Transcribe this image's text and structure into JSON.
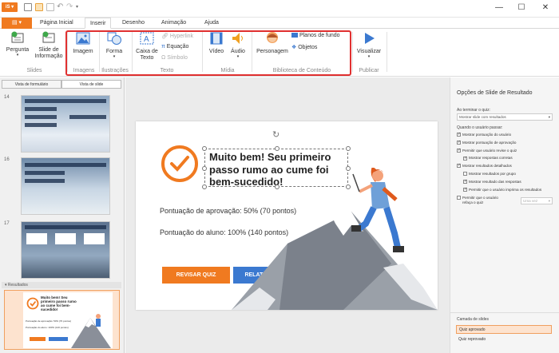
{
  "tabs": {
    "file": "Página Inicial",
    "items": [
      "Página Inicial",
      "Inserir",
      "Desenho",
      "Animação",
      "Ajuda"
    ],
    "active": 1
  },
  "ribbon": {
    "pergunta": "Pergunta",
    "slide_info": "Slide de\nInformação",
    "imagem": "Imagem",
    "forma": "Forma",
    "caixa_texto": "Caixa de\nTexto",
    "hyperlink": "Hyperlink",
    "equacao": "Equação",
    "simbolo": "Símbolo",
    "video": "Vídeo",
    "audio": "Áudio",
    "personagem": "Personagem",
    "planos_fundo": "Planos de fundo",
    "objetos": "Objetos",
    "visualizar": "Visualizar",
    "groups": {
      "slides": "Slides",
      "imagens": "Imagens",
      "ilustracoes": "Ilustrações",
      "texto": "Texto",
      "midia": "Mídia",
      "biblioteca": "Biblioteca de Conteúdo",
      "publicar": "Publicar"
    }
  },
  "left": {
    "view_form": "Vista de formulário",
    "view_slide": "Vista de slide",
    "slides": [
      "14",
      "16",
      "17"
    ],
    "section": "Resultados"
  },
  "slide": {
    "headline": "Muito bem! Seu primeiro passo rumo ao cume foi bem-sucedido!",
    "passing": "Pontuação de aprovação: 50% (70 pontos)",
    "student": "Pontuação do aluno: 100% (140 pontos)",
    "btn_review": "REVISAR QUIZ",
    "btn_report": "RELATÓRIO DETALHADO"
  },
  "right": {
    "title": "Opções de Slide de Resultado",
    "end_label": "Ao terminar o quiz:",
    "end_value": "Mostrar slide com resultados",
    "pass_label": "Quando o usuário passar:",
    "options": [
      {
        "text": "Mostrar pontuação do usuário",
        "on": true,
        "indent": 0
      },
      {
        "text": "Mostrar pontuação de aprovação",
        "on": true,
        "indent": 0
      },
      {
        "text": "Permitir que usuário revise o quiz",
        "on": true,
        "indent": 0
      },
      {
        "text": "Mostrar respostas corretas",
        "on": true,
        "indent": 1
      },
      {
        "text": "Mostrar resultados detalhados",
        "on": true,
        "indent": 0
      },
      {
        "text": "Mostrar resultados por grupo",
        "on": false,
        "indent": 1
      },
      {
        "text": "Mostrar resultado das respostas",
        "on": true,
        "indent": 1
      },
      {
        "text": "Permitir que o usuário imprima os resultados",
        "on": true,
        "indent": 1
      }
    ],
    "retake_text": "Permitir que o usuário refaça o quiz",
    "retake_value": "Uma vez",
    "layer_title": "Camada de slides",
    "layers": [
      "Quiz aprovado",
      "Quiz reprovado"
    ]
  },
  "colors": {
    "accent": "#f07a20",
    "blue": "#3b79d0",
    "highlight": "#e03030"
  }
}
